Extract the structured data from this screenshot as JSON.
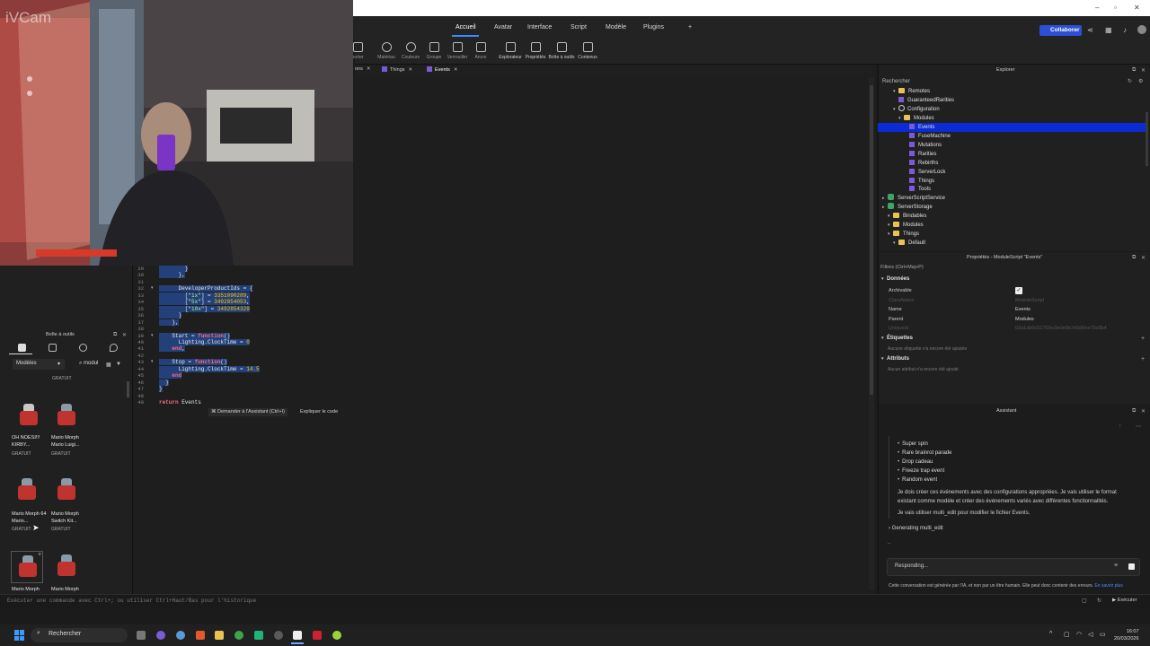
{
  "menu": {
    "tabs": [
      "Accueil",
      "Avatar",
      "Interface",
      "Script",
      "Modèle",
      "Plugins"
    ],
    "active": "Accueil",
    "add": "+",
    "collaborate": "Collaborer"
  },
  "toolbar": {
    "items": [
      "porter",
      "Matériau",
      "Couleurs",
      "Groupe",
      "Verrouiller",
      "Ancre",
      "Explorateur",
      "Propriétés",
      "Boîte à outils",
      "Contenus"
    ]
  },
  "doc_tabs": [
    {
      "label": "ons"
    },
    {
      "label": "Things"
    },
    {
      "label": "Events"
    }
  ],
  "editor": {
    "line_numbers": [
      "29",
      "30",
      "31",
      "32",
      "33",
      "34",
      "35",
      "36",
      "37",
      "38",
      "39",
      "40",
      "41",
      "42",
      "43",
      "44",
      "45",
      "46",
      "47",
      "48",
      "49"
    ],
    "lines": [
      "        }",
      "      },",
      "",
      "      DeveloperProductIds = {",
      "        [\"1x\"] = 3351090289,",
      "        [\"5x\"] = 3492854053,",
      "        [\"10x\"] = 3492854329",
      "      }",
      "    },",
      "",
      "    Start = function()",
      "      Lighting.ClockTime = 0",
      "    end,",
      "",
      "    Stop = function()",
      "      Lighting.ClockTime = 14.5",
      "    end",
      "  }",
      "}",
      "",
      "return Events"
    ],
    "assistant_hint": "Demander à l'Assistant (Ctrl+I)",
    "explain": "Expliquer le code"
  },
  "toolbox": {
    "title": "Boîte à outils",
    "category": "Modèles",
    "search": "modul",
    "top_price": "GRATUIT",
    "items": [
      {
        "name": "OH NOESI!!! KIRBY...",
        "price": "GRATUIT"
      },
      {
        "name": "Mario Morph Mario Luigi...",
        "price": "GRATUIT"
      },
      {
        "name": "Mario Morph 64 Mario...",
        "price": "GRATUIT"
      },
      {
        "name": "Mario Morph Switch Kit...",
        "price": "GRATUIT"
      },
      {
        "name": "Mario Morph",
        "price": ""
      },
      {
        "name": "Mario Morph",
        "price": ""
      }
    ]
  },
  "command_bar": {
    "placeholder": "Exécuter une commande avec Ctrl+; ou utiliser Ctrl+Haut/Bas pour l'historique",
    "run": "Exécuter"
  },
  "explorer": {
    "title": "Explorer",
    "search_placeholder": "Rechercher",
    "tree": [
      {
        "label": "Remotes",
        "kind": "folder",
        "indent": 2
      },
      {
        "label": "GuaranteedRarities",
        "kind": "module",
        "indent": 2
      },
      {
        "label": "Configuration",
        "kind": "config",
        "indent": 2
      },
      {
        "label": "Modules",
        "kind": "folder",
        "indent": 3
      },
      {
        "label": "Events",
        "kind": "module",
        "indent": 4,
        "selected": true
      },
      {
        "label": "FuseMachine",
        "kind": "module",
        "indent": 4
      },
      {
        "label": "Mutations",
        "kind": "module",
        "indent": 4
      },
      {
        "label": "Rarities",
        "kind": "module",
        "indent": 4
      },
      {
        "label": "Rebirths",
        "kind": "module",
        "indent": 4
      },
      {
        "label": "ServerLock",
        "kind": "module",
        "indent": 4
      },
      {
        "label": "Things",
        "kind": "module",
        "indent": 4
      },
      {
        "label": "Tools",
        "kind": "module",
        "indent": 4
      },
      {
        "label": "ServerScriptService",
        "kind": "service",
        "indent": 0
      },
      {
        "label": "ServerStorage",
        "kind": "service",
        "indent": 0
      },
      {
        "label": "Bindables",
        "kind": "folder",
        "indent": 1
      },
      {
        "label": "Modules",
        "kind": "folder",
        "indent": 1
      },
      {
        "label": "Things",
        "kind": "folder",
        "indent": 1
      },
      {
        "label": "Default",
        "kind": "folder",
        "indent": 2
      }
    ]
  },
  "properties": {
    "title": "Propriétés - ModuleScript \"Events\"",
    "filter": "Filtres (Ctrl+Maj+P)",
    "sections": {
      "data": "Données",
      "tags": "Étiquettes",
      "attributes": "Attributs"
    },
    "rows": [
      {
        "key": "Archivable",
        "value": "",
        "check": true
      },
      {
        "key": "ClassName",
        "value": "ModuleScript",
        "dim": true
      },
      {
        "key": "Name",
        "value": "Events"
      },
      {
        "key": "Parent",
        "value": "Modules"
      },
      {
        "key": "UniqueId",
        "value": "02a1ab0c917f2ec9e0e0b7d0d0ee70c8b4",
        "dim": true
      }
    ],
    "tags_empty": "Aucune étiquette n'a encore été ajoutée",
    "attributes_empty": "Aucun attribut n'a encore été ajouté"
  },
  "assistant": {
    "title": "Assistant",
    "bullets": [
      "Super spin",
      "Rare brainrot parade",
      "Drop cadeau",
      "Freeze trap event",
      "Random event"
    ],
    "paragraph1": "Je dois créer ces événements avec des configurations appropriées. Je vais utiliser le format existant comme modèle et créer des événements variés avec différentes fonctionnalités.",
    "paragraph2": "Je vais utiliser multi_edit pour modifier le fichier Events.",
    "generating": "Generating multi_edit",
    "dots": "..",
    "status": "Responding...",
    "footer": "Cette conversation est générée par l'IA, et non par un être humain. Elle peut donc contenir des erreurs.",
    "footer_link": "En savoir plus"
  },
  "taskbar": {
    "search": "Rechercher",
    "time": "16:07",
    "date": "20/03/2026"
  },
  "webcam": {
    "watermark": "iVCam"
  }
}
